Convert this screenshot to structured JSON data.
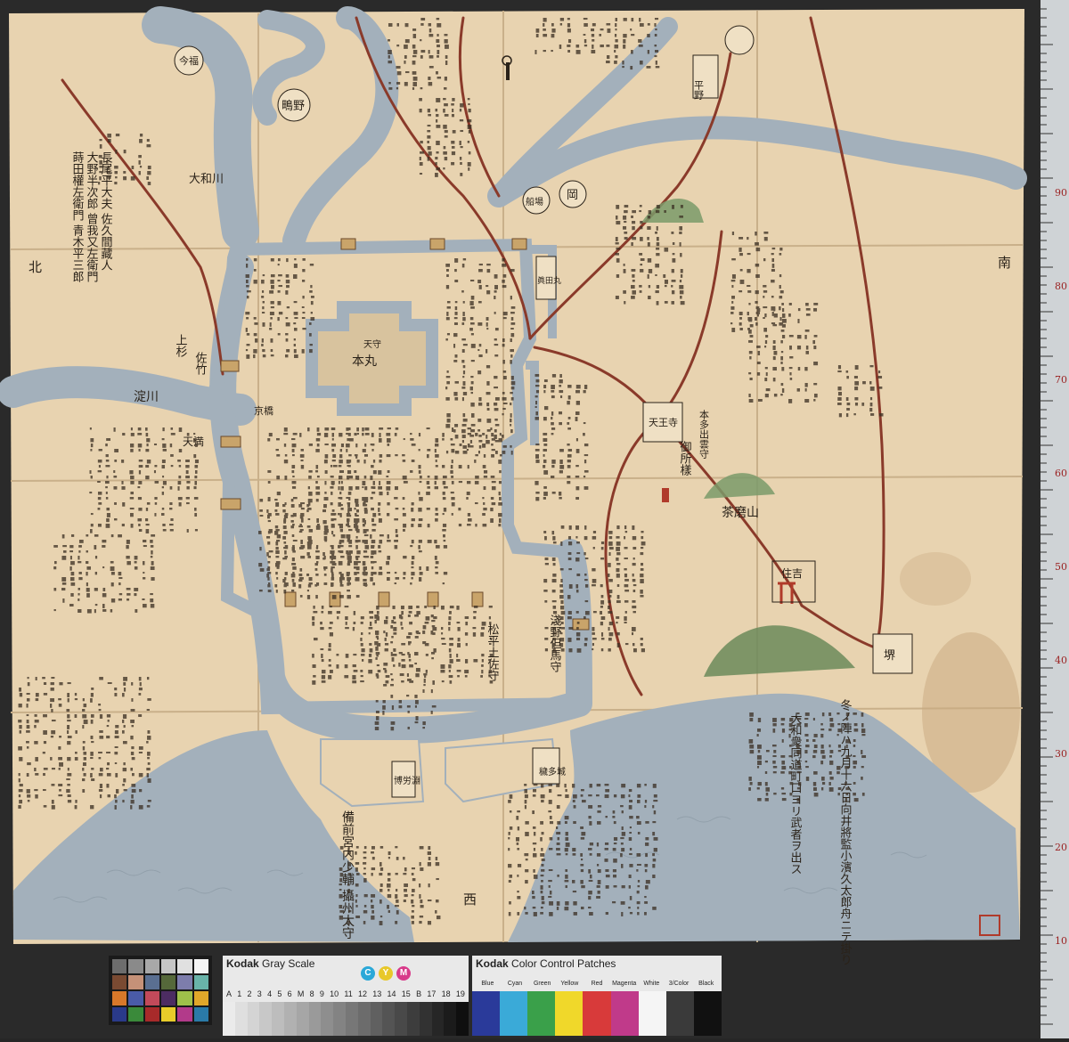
{
  "map": {
    "directions": {
      "north": "北",
      "south": "南",
      "west": "西"
    },
    "castle_label": "本丸",
    "tenmaru_label": "天守",
    "places": {
      "imamiya": "今福",
      "shigino": "鴫野",
      "hirano": "平野",
      "tennoji": "天王寺",
      "chausuyama": "茶磨山",
      "sumiyoshi": "住吉",
      "sakai": "堺",
      "sanadamaru": "眞田丸",
      "tenma": "天満",
      "kyobashi": "京橋",
      "tsunaka": "穢多城",
      "hakuro": "博労淵",
      "yamato_river": "大和川",
      "yodo_river": "淀川",
      "okada": "岡",
      "senba": "船場"
    },
    "annotations": {
      "topleft_a": "長尾平大夫 佐久間藏人",
      "topleft_b": "大野半次郎 曾我又左衛門",
      "topleft_c": "蒔田權左衛門 青木平三郎",
      "west_note": "備前宮内少輔 攝州太守",
      "south_note_a": "冬ノ陣ハ九月十六日向井將監小濱久太郎舟ニテ掛り",
      "south_note_b": "大和衆同道町口ヨリ武者ヲ出ス",
      "center_commander": "松平土佐守",
      "east_commander": "淺野但馬守",
      "north_commander": "上杉",
      "north_commander2": "佐竹",
      "tennoji_note": "本多出雲守",
      "chausu_note": "御所樣"
    }
  },
  "scale_bars": {
    "gray_brand": "Kodak",
    "gray_title": "Gray Scale",
    "gray_letters": [
      "A",
      "1",
      "2",
      "3",
      "4",
      "5",
      "6",
      "M",
      "8",
      "9",
      "10",
      "11",
      "12",
      "13",
      "14",
      "15",
      "B",
      "17",
      "18",
      "19"
    ],
    "color_brand": "Kodak",
    "color_title": "Color Control Patches",
    "color_patches": [
      "Blue",
      "Cyan",
      "Green",
      "Yellow",
      "Red",
      "Magenta",
      "White",
      "3/Color",
      "Black"
    ],
    "cym": [
      "C",
      "Y",
      "M"
    ],
    "ruler_numbers": [
      "10",
      "20",
      "30",
      "40",
      "50",
      "60",
      "70",
      "80",
      "90"
    ]
  },
  "colors": {
    "paper": "#e8d3b0",
    "water": "#a3b0bb",
    "road": "#8a3a2a",
    "ink": "#2a2219",
    "hill": "#7a9a6a"
  }
}
